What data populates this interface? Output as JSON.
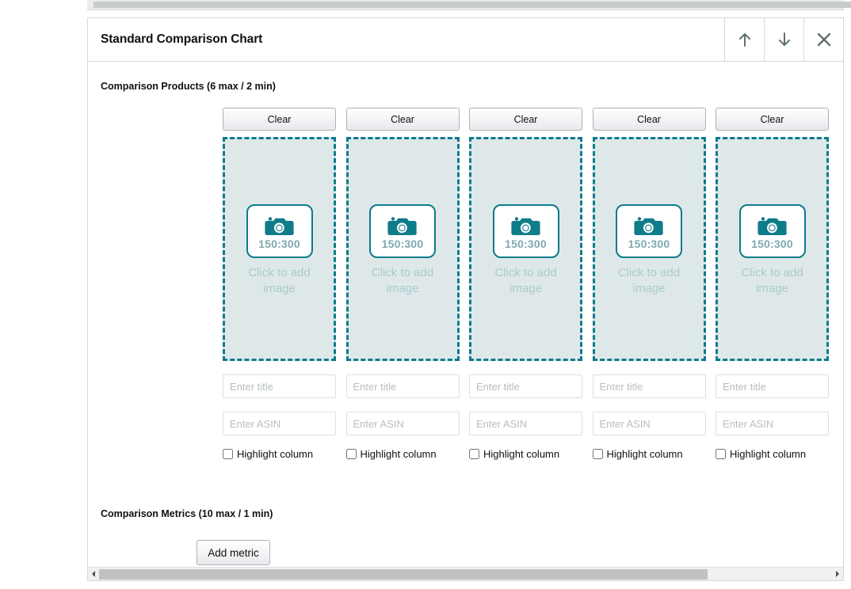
{
  "panel": {
    "title": "Standard Comparison Chart",
    "header_buttons": [
      {
        "name": "move-up-button",
        "icon": "arrow-up-icon",
        "label": "Move up"
      },
      {
        "name": "move-down-button",
        "icon": "arrow-down-icon",
        "label": "Move down"
      },
      {
        "name": "close-button",
        "icon": "close-icon",
        "label": "Close"
      }
    ]
  },
  "products_section": {
    "label": "Comparison Products (6 max / 2 min)",
    "clear_label": "Clear",
    "dropzone": {
      "ratio": "150:300",
      "prompt": "Click to add image",
      "icon": "camera-icon"
    },
    "title_placeholder": "Enter title",
    "title_value": "",
    "asin_placeholder": "Enter ASIN",
    "asin_value": "",
    "highlight_label": "Highlight column",
    "columns": [
      {
        "clear": "Clear",
        "ratio": "150:300",
        "prompt": "Click to add image",
        "title_placeholder": "Enter title",
        "asin_placeholder": "Enter ASIN",
        "highlight_label": "Highlight column",
        "highlight_checked": false
      },
      {
        "clear": "Clear",
        "ratio": "150:300",
        "prompt": "Click to add image",
        "title_placeholder": "Enter title",
        "asin_placeholder": "Enter ASIN",
        "highlight_label": "Highlight column",
        "highlight_checked": false
      },
      {
        "clear": "Clear",
        "ratio": "150:300",
        "prompt": "Click to add image",
        "title_placeholder": "Enter title",
        "asin_placeholder": "Enter ASIN",
        "highlight_label": "Highlight column",
        "highlight_checked": false
      },
      {
        "clear": "Clear",
        "ratio": "150:300",
        "prompt": "Click to add image",
        "title_placeholder": "Enter title",
        "asin_placeholder": "Enter ASIN",
        "highlight_label": "Highlight column",
        "highlight_checked": false
      },
      {
        "clear": "Clear",
        "ratio": "150:300",
        "prompt": "Click to add image",
        "title_placeholder": "Enter title",
        "asin_placeholder": "Enter ASIN",
        "highlight_label": "Highlight column",
        "highlight_checked": false
      }
    ]
  },
  "metrics_section": {
    "label": "Comparison Metrics (10 max / 1 min)",
    "add_metric_label": "Add metric"
  },
  "colors": {
    "accent_teal": "#0b7b8c",
    "dropzone_fill": "#dfe8e9",
    "prompt_text": "#a8cbcd",
    "ratio_text": "#7fa9ae",
    "panel_border": "#d5d9d9",
    "text_primary": "#0f1111",
    "icon_gray": "#5f7070",
    "scrollbar_thumb": "#c1c1c1"
  }
}
